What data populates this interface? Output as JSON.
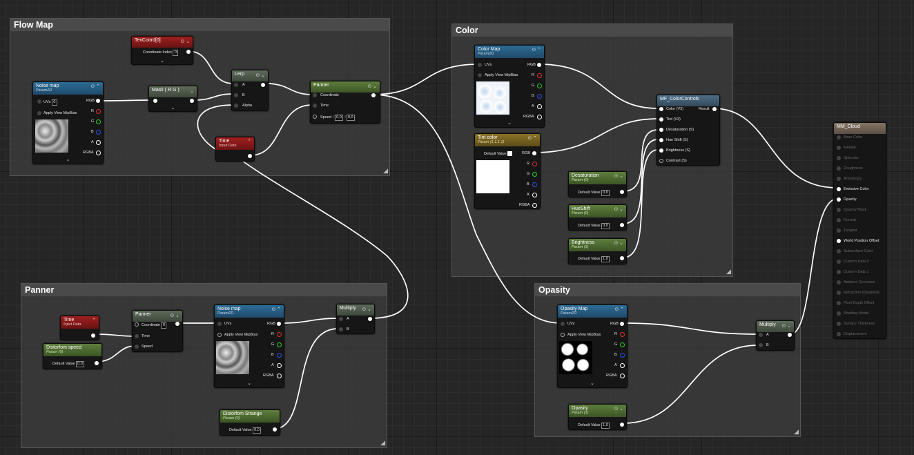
{
  "comments": {
    "flow_map": "Flow Map",
    "color": "Color",
    "panner": "Panner",
    "opasity": "Opasity"
  },
  "nodes": {
    "texcoord": {
      "title": "TexCoord[0]",
      "coordinate_index_label": "Coordinate Index",
      "coordinate_index": "0"
    },
    "noise_map_1": {
      "title": "Noise map",
      "subtitle": "Param2D",
      "uvs_label": "UVs",
      "uvs_value": "0",
      "mip_label": "Apply View MipBias",
      "outputs": [
        "RGB",
        "R",
        "G",
        "B",
        "A",
        "RGBA"
      ]
    },
    "mask": {
      "title": "Mask ( R G )"
    },
    "lerp": {
      "title": "Lerp",
      "inputs": [
        "A",
        "B",
        "Alpha"
      ]
    },
    "time_1": {
      "title": "Time",
      "subtitle": "Input Data"
    },
    "panner_1": {
      "title": "Panner",
      "inputs": [
        "Coordinate",
        "Time",
        "Speed"
      ],
      "speed_x_label": "X",
      "speed_x": "0,0",
      "speed_y_label": "Y",
      "speed_y": "0,0"
    },
    "color_map": {
      "title": "Color Map",
      "subtitle": "Param2D",
      "uvs_label": "UVs",
      "mip_label": "Apply View MipBias",
      "outputs": [
        "RGB",
        "R",
        "G",
        "B",
        "A",
        "RGBA"
      ]
    },
    "tint_color": {
      "title": "Tint color",
      "subtitle": "Param (1,1,1,1)",
      "default_label": "Default Value",
      "outputs": [
        "RGB",
        "R",
        "G",
        "B",
        "A",
        "RGBA"
      ]
    },
    "mf_color_controls": {
      "title": "MF_ColorControls",
      "inputs": [
        "Color (V3)",
        "Tint (V3)",
        "Desaturation (S)",
        "Hue Shift (S)",
        "Brightness (S)",
        "Contrast (S)"
      ],
      "output": "Result"
    },
    "desaturation": {
      "title": "Desaturation",
      "subtitle": "Param (0)",
      "default_label": "Default Value",
      "value": "0,0"
    },
    "hueshift": {
      "title": "HueShift",
      "subtitle": "Param (0)",
      "default_label": "Default Value",
      "value": "0,0"
    },
    "brightness": {
      "title": "Brightness",
      "subtitle": "Param (1)",
      "default_label": "Default Value",
      "value": "1,0"
    },
    "mm_cloud": {
      "title": "MM_Cloud",
      "pins": [
        "Base Color",
        "Metallic",
        "Specular",
        "Roughness",
        "Anisotropy",
        "Emissive Color",
        "Opacity",
        "Opacity Mask",
        "Normal",
        "Tangent",
        "World Position Offset",
        "Subsurface Color",
        "Custom Data 0",
        "Custom Data 1",
        "Ambient Occlusion",
        "Refraction (Disabled)",
        "Pixel Depth Offset",
        "Shading Model",
        "Surface Thickness",
        "Displacement"
      ],
      "active": [
        5,
        6,
        10
      ]
    },
    "time_2": {
      "title": "Time",
      "subtitle": "Input Data"
    },
    "distorfom_speed": {
      "title": "Distorfom speed",
      "subtitle": "Param (0)",
      "default_label": "Default Value",
      "value": "0,0"
    },
    "panner_2": {
      "title": "Panner",
      "inputs": [
        "Coordinate",
        "Time",
        "Speed"
      ],
      "coordinate_value": "0"
    },
    "noise_map_2": {
      "title": "Noise map",
      "subtitle": "Param2D",
      "uvs_label": "UVs",
      "mip_label": "Apply View MipBias",
      "outputs": [
        "RGB",
        "R",
        "G",
        "B",
        "A",
        "RGBA"
      ]
    },
    "multiply_1": {
      "title": "Multiply",
      "inputs": [
        "A",
        "B"
      ]
    },
    "distorfom_strange": {
      "title": "Distorfom Strange",
      "subtitle": "Param (0)",
      "default_label": "Default Value",
      "value": "0,0"
    },
    "opasity_map": {
      "title": "Opasity Map",
      "subtitle": "Param2D",
      "uvs_label": "UVs",
      "mip_label": "Apply View MipBias",
      "outputs": [
        "RGB",
        "R",
        "G",
        "B",
        "A",
        "RGBA"
      ]
    },
    "multiply_2": {
      "title": "Multiply",
      "inputs": [
        "A",
        "B"
      ]
    },
    "opasity": {
      "title": "Opasity",
      "subtitle": "Param (1)",
      "default_label": "Default Value",
      "value": "1,0"
    }
  },
  "colors": {
    "red_channel": "#e03030",
    "green_channel": "#30d030",
    "blue_channel": "#3050e0",
    "wire": "#ffffff"
  }
}
